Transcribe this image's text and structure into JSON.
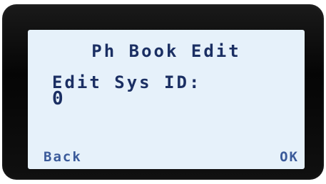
{
  "screen": {
    "title": "Ph Book Edit",
    "field_label": "Edit Sys ID:",
    "field_value": "0"
  },
  "softkeys": {
    "left": "Back",
    "right": "OK"
  },
  "colors": {
    "lcd_background": "#e6f1fa",
    "lcd_text": "#1b2f63",
    "bezel": "#0a0a0a"
  }
}
